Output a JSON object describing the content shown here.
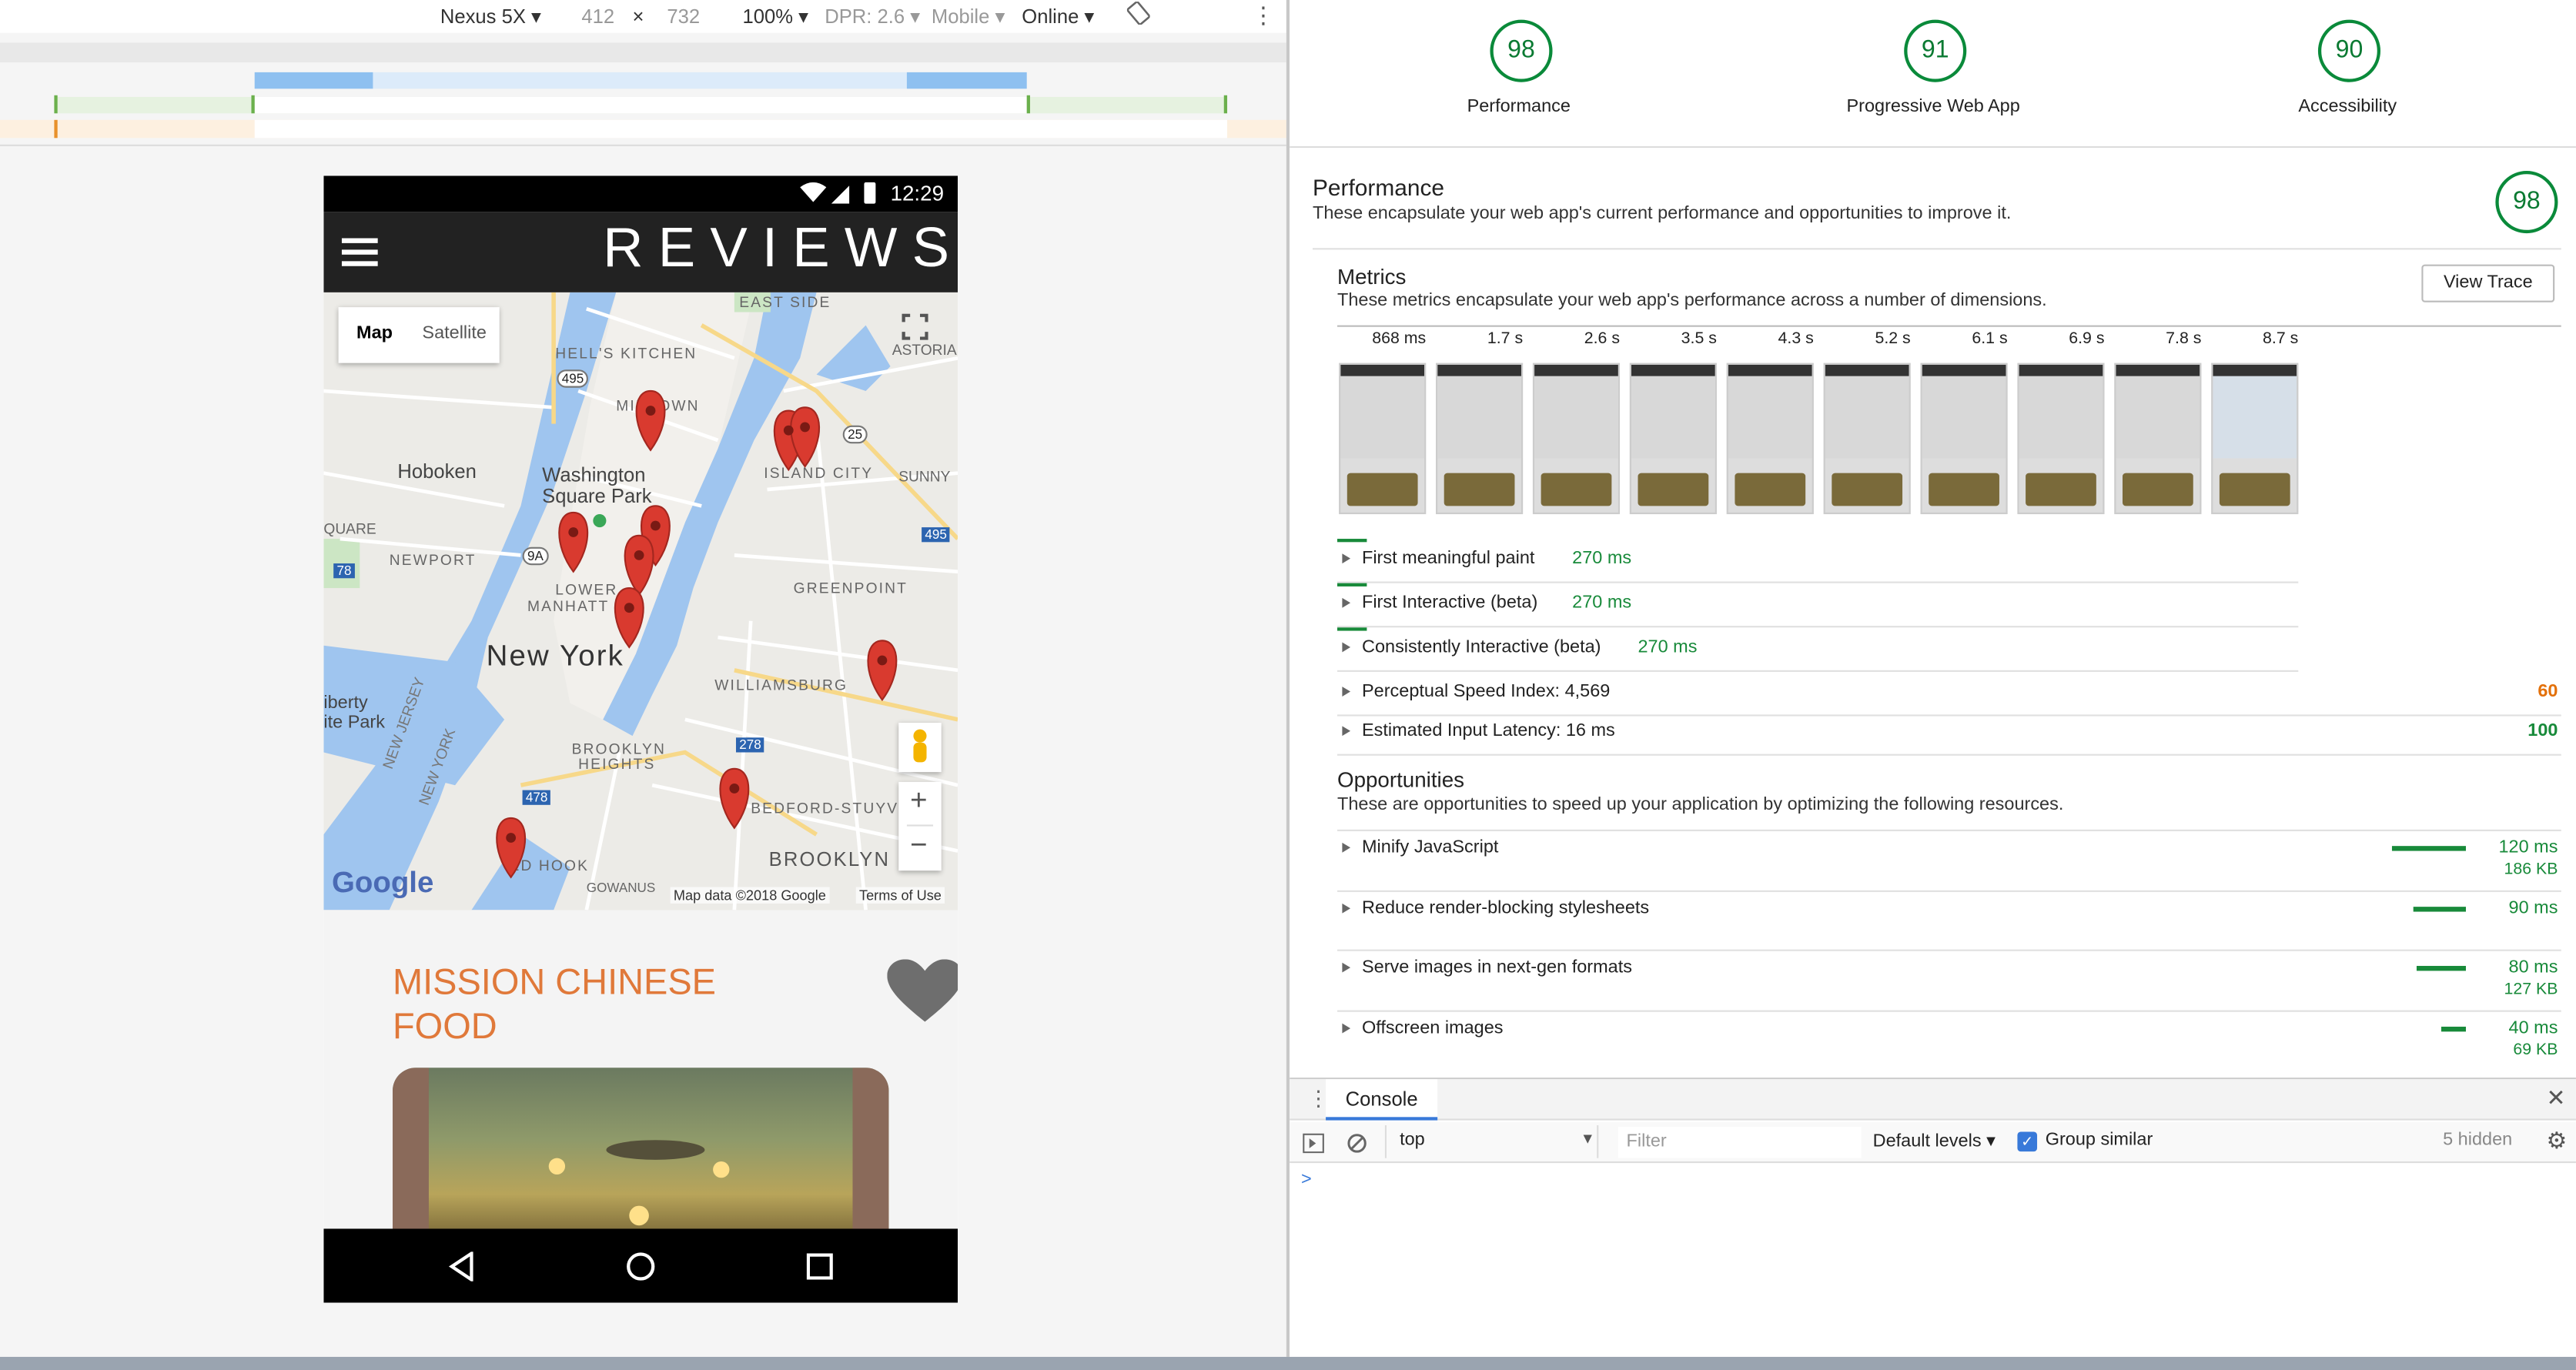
{
  "device_toolbar": {
    "device": "Nexus 5X",
    "width": "412",
    "times": "×",
    "height": "732",
    "zoom": "100%",
    "dpr": "DPR: 2.6",
    "mode": "Mobile",
    "network": "Online"
  },
  "phone": {
    "status_time": "12:29",
    "app_title": "REVIEWS",
    "map": {
      "tab_map": "Map",
      "tab_satellite": "Satellite",
      "labels": {
        "east_side": "EAST SIDE",
        "hells_kitchen": "HELL'S KITCHEN",
        "astoria": "ASTORIA",
        "midtown": "MIDTOWN",
        "hoboken": "Hoboken",
        "washington": "Washington",
        "square_park": "Square Park",
        "island_city": "ISLAND CITY",
        "sunny": "SUNNY",
        "square": "QUARE",
        "newport": "NEWPORT",
        "lower": "LOWER",
        "manhattan": "MANHATT",
        "greenpoint": "GREENPOINT",
        "new_york": "New York",
        "williamsburg": "WILLIAMSBURG",
        "liberty": "iberty",
        "state_park": "ite Park",
        "brooklyn_heights_1": "BROOKLYN",
        "brooklyn_heights_2": "HEIGHTS",
        "new_jersey": "NEW JERSEY",
        "new_york_state": "NEW YORK",
        "bedford": "BEDFORD-STUYVE",
        "red_hook": "ED HOOK",
        "gowanus": "GOWANUS",
        "brooklyn": "BROOKLYN",
        "shield_495": "495",
        "shield_25": "25",
        "shield_9a": "9A",
        "shield_78": "78",
        "shield_495b": "495",
        "shield_278": "278",
        "shield_478": "478"
      },
      "google": "Google",
      "map_data": "Map data ©2018 Google",
      "terms": "Terms of Use",
      "zoom_in": "+",
      "zoom_out": "−"
    },
    "restaurant_line1": "MISSION CHINESE",
    "restaurant_line2": "FOOD"
  },
  "scores": [
    {
      "value": "98",
      "label": "Performance"
    },
    {
      "value": "91",
      "label": "Progressive Web App"
    },
    {
      "value": "90",
      "label": "Accessibility"
    }
  ],
  "performance": {
    "title": "Performance",
    "description": "These encapsulate your web app's current performance and opportunities to improve it.",
    "score": "98"
  },
  "metrics": {
    "title": "Metrics",
    "description": "These metrics encapsulate your web app's performance across a number of dimensions.",
    "view_trace": "View Trace",
    "filmstrip_times": [
      "868 ms",
      "1.7 s",
      "2.6 s",
      "3.5 s",
      "4.3 s",
      "5.2 s",
      "6.1 s",
      "6.9 s",
      "7.8 s",
      "8.7 s"
    ],
    "rows": [
      {
        "name": "First meaningful paint",
        "value": "270 ms",
        "score": ""
      },
      {
        "name": "First Interactive (beta)",
        "value": "270 ms",
        "score": ""
      },
      {
        "name": "Consistently Interactive (beta)",
        "value": "270 ms",
        "score": ""
      },
      {
        "name": "Perceptual Speed Index: 4,569",
        "value": "",
        "score": "60"
      },
      {
        "name": "Estimated Input Latency: 16 ms",
        "value": "",
        "score": "100"
      }
    ]
  },
  "opportunities": {
    "title": "Opportunities",
    "description": "These are opportunities to speed up your application by optimizing the following resources.",
    "items": [
      {
        "name": "Minify JavaScript",
        "time": "120 ms",
        "size": "186 KB",
        "bar": 1.0
      },
      {
        "name": "Reduce render-blocking stylesheets",
        "time": "90 ms",
        "size": "",
        "bar": 0.72
      },
      {
        "name": "Serve images in next-gen formats",
        "time": "80 ms",
        "size": "127 KB",
        "bar": 0.67
      },
      {
        "name": "Offscreen images",
        "time": "40 ms",
        "size": "69 KB",
        "bar": 0.33
      }
    ]
  },
  "console": {
    "tab": "Console",
    "context": "top",
    "filter_placeholder": "Filter",
    "levels": "Default levels",
    "group_similar": "Group similar",
    "hidden": "5 hidden",
    "prompt": ">"
  },
  "colors": {
    "good": "#188a3a",
    "average": "#e3700a",
    "accent": "#e0793a",
    "pin": "#d93a2f"
  }
}
